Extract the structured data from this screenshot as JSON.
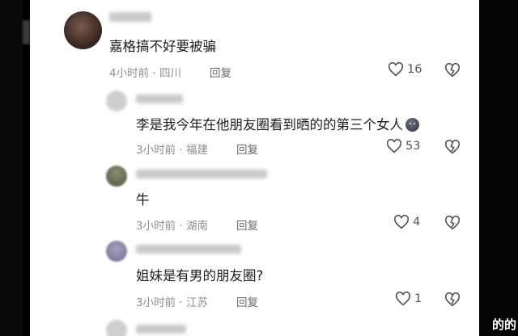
{
  "comments": [
    {
      "text": "嘉格搞不好要被骗",
      "meta": "4小时前 · 四川",
      "reply": "回复",
      "likes": "16"
    },
    {
      "text": "李是我今年在他朋友圈看到晒的的第三个女人",
      "meta": "3小时前 · 福建",
      "reply": "回复",
      "likes": "53"
    },
    {
      "text": "牛",
      "meta": "3小时前 · 湖南",
      "reply": "回复",
      "likes": "4"
    },
    {
      "text": "姐妹是有男的朋友圈?",
      "meta": "3小时前 · 江苏",
      "reply": "回复",
      "likes": "1"
    }
  ],
  "watermark": "的的",
  "colors": {
    "text": "#1d1d1d",
    "meta": "#8e8e8e",
    "icon": "#555555"
  },
  "icons": [
    "heart-icon",
    "broken-heart-icon",
    "emoji-icon"
  ]
}
